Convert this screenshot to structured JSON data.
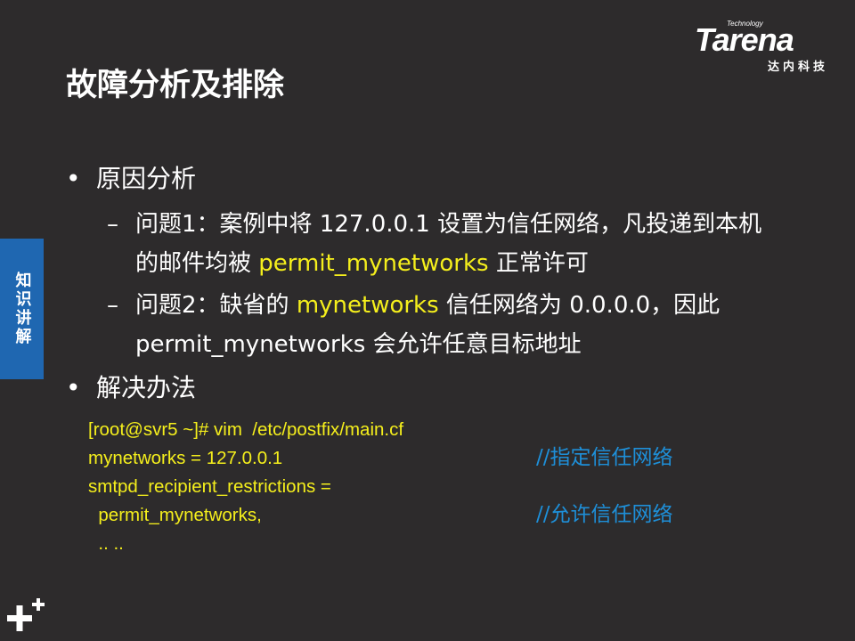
{
  "logo": {
    "technology": "Technology",
    "word": "Tarena",
    "cn": "达内科技"
  },
  "title": "故障分析及排除",
  "side_tab": "知识讲解",
  "sections": {
    "cause": {
      "heading": "原因分析",
      "items": [
        {
          "pre": "问题1：案例中将 127.0.0.1 设置为信任网络，凡投递到本机的邮件均被 ",
          "highlight": "permit_mynetworks",
          "post": " 正常许可"
        },
        {
          "pre": "问题2：缺省的 ",
          "highlight": "mynetworks",
          "post": " 信任网络为 0.0.0.0，因此 permit_mynetworks 会允许任意目标地址"
        }
      ]
    },
    "solution": {
      "heading": "解决办法"
    }
  },
  "code": {
    "lines": [
      "[root@svr5 ~]# vim  /etc/postfix/main.cf",
      "mynetworks = 127.0.0.1",
      "smtpd_recipient_restrictions =",
      "  permit_mynetworks,",
      "  .. .."
    ],
    "comments": {
      "line2": "//指定信任网络",
      "line4": "//允许信任网络"
    }
  },
  "colors": {
    "background": "#2d2b2c",
    "highlight": "#f5ef1c",
    "comment": "#1e8fd8",
    "side_tab": "#1f67b1"
  }
}
